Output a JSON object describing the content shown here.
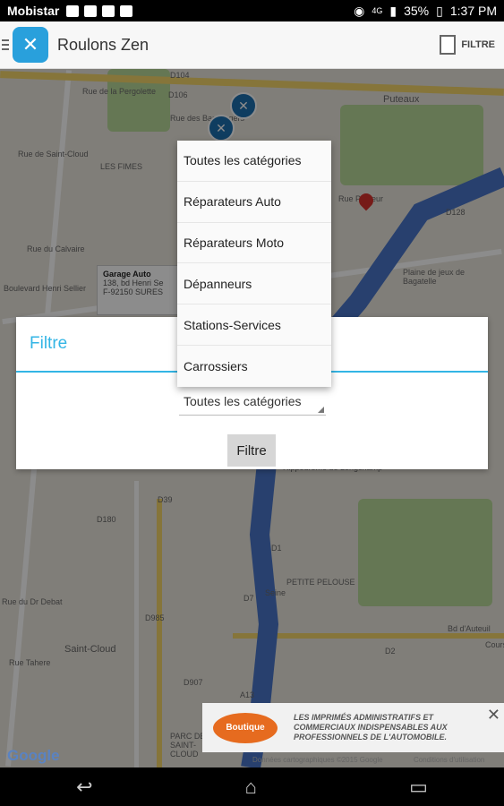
{
  "status_bar": {
    "carrier": "Mobistar",
    "battery": "35%",
    "time": "1:37 PM",
    "network": "4G"
  },
  "action_bar": {
    "title": "Roulons Zen",
    "filter_label": "FILTRE"
  },
  "map": {
    "labels": [
      "Puteaux",
      "LES FIMES",
      "Saint-Cloud",
      "Hippodrome de Longchamp",
      "Plaine de jeux de Bagatelle",
      "Seine",
      "PARC DE SAINT-CLOUD",
      "PETITE PELOUSE",
      "D106",
      "D104",
      "D128",
      "D1",
      "D7",
      "D2",
      "D39",
      "D907",
      "A13",
      "D985",
      "D180",
      "Bd d'Auteuil",
      "Cours",
      "Rue de Saint-Cloud",
      "Boulevard Henri Sellier",
      "Rue de la Pergolette",
      "Rue des Bas Rogers",
      "Rue du Calvaire",
      "Rue du Dr Debat",
      "Rue Pasteur",
      "Rue Tahere"
    ],
    "info_window": {
      "title": "Garage Auto",
      "address_line1": "138, bd Henri Se",
      "address_line2": "F-92150 SURES"
    },
    "attribution": "Données cartographiques ©2015 Google",
    "terms": "Conditions d'utilisation",
    "logo": "Google"
  },
  "dialog": {
    "title": "Filtre",
    "spinner_value": "Toutes les catégories",
    "button_label": "Filtre"
  },
  "dropdown": {
    "items": [
      "Toutes les catégories",
      "Réparateurs Auto",
      "Réparateurs Moto",
      "Dépanneurs",
      "Stations-Services",
      "Carrossiers"
    ]
  },
  "ad": {
    "logo_text": "Boutique",
    "text": "LES IMPRIMÉS ADMINISTRATIFS ET COMMERCIAUX INDISPENSABLES AUX PROFESSIONNELS DE L'AUTOMOBILE."
  },
  "colors": {
    "accent": "#33b5e5",
    "pin": "#1d6fb0",
    "marker": "#d8322c",
    "river": "#4a76c8"
  }
}
